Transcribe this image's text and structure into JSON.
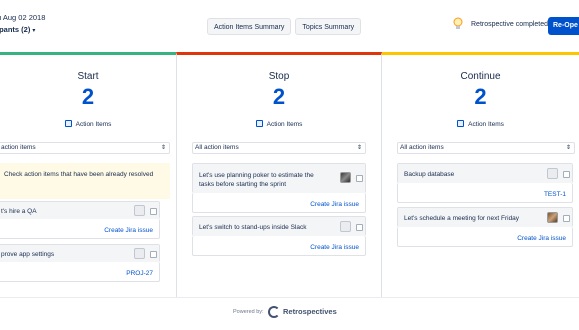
{
  "header": {
    "date": "u Aug 02 2018",
    "participants": "ipants (2)",
    "action_items_summary": "Action Items Summary",
    "topics_summary": "Topics Summary",
    "status": "Retrospective completed",
    "reopen": "Re-Ope"
  },
  "columns": {
    "start": {
      "title": "Start",
      "count": "2",
      "ai_label": "Action Items",
      "filter": "action items",
      "notice": "Check action items that have been already resolved",
      "cards": [
        {
          "text": "t's hire a QA",
          "link": "Create Jira issue"
        },
        {
          "text": "prove app settings",
          "link": "PROJ-27"
        }
      ]
    },
    "stop": {
      "title": "Stop",
      "count": "2",
      "ai_label": "Action Items",
      "filter": "All action items",
      "cards": [
        {
          "text": "Let's use planning poker to estimate the tasks before starting the sprint",
          "link": "Create Jira issue"
        },
        {
          "text": "Let's switch to stand-ups inside Slack",
          "link": "Create Jira issue"
        }
      ]
    },
    "continue": {
      "title": "Continue",
      "count": "2",
      "ai_label": "Action Items",
      "filter": "All action items",
      "cards": [
        {
          "text": "Backup database",
          "link": "TEST-1"
        },
        {
          "text": "Let's schedule a meeting for next Friday",
          "link": "Create Jira issue"
        }
      ]
    }
  },
  "footer": {
    "powered_by": "Powered by:",
    "brand": "Retrospectives"
  },
  "colors": {
    "start": "#36b37e",
    "stop": "#de350b",
    "continue": "#ffc400",
    "link": "#0052cc"
  }
}
